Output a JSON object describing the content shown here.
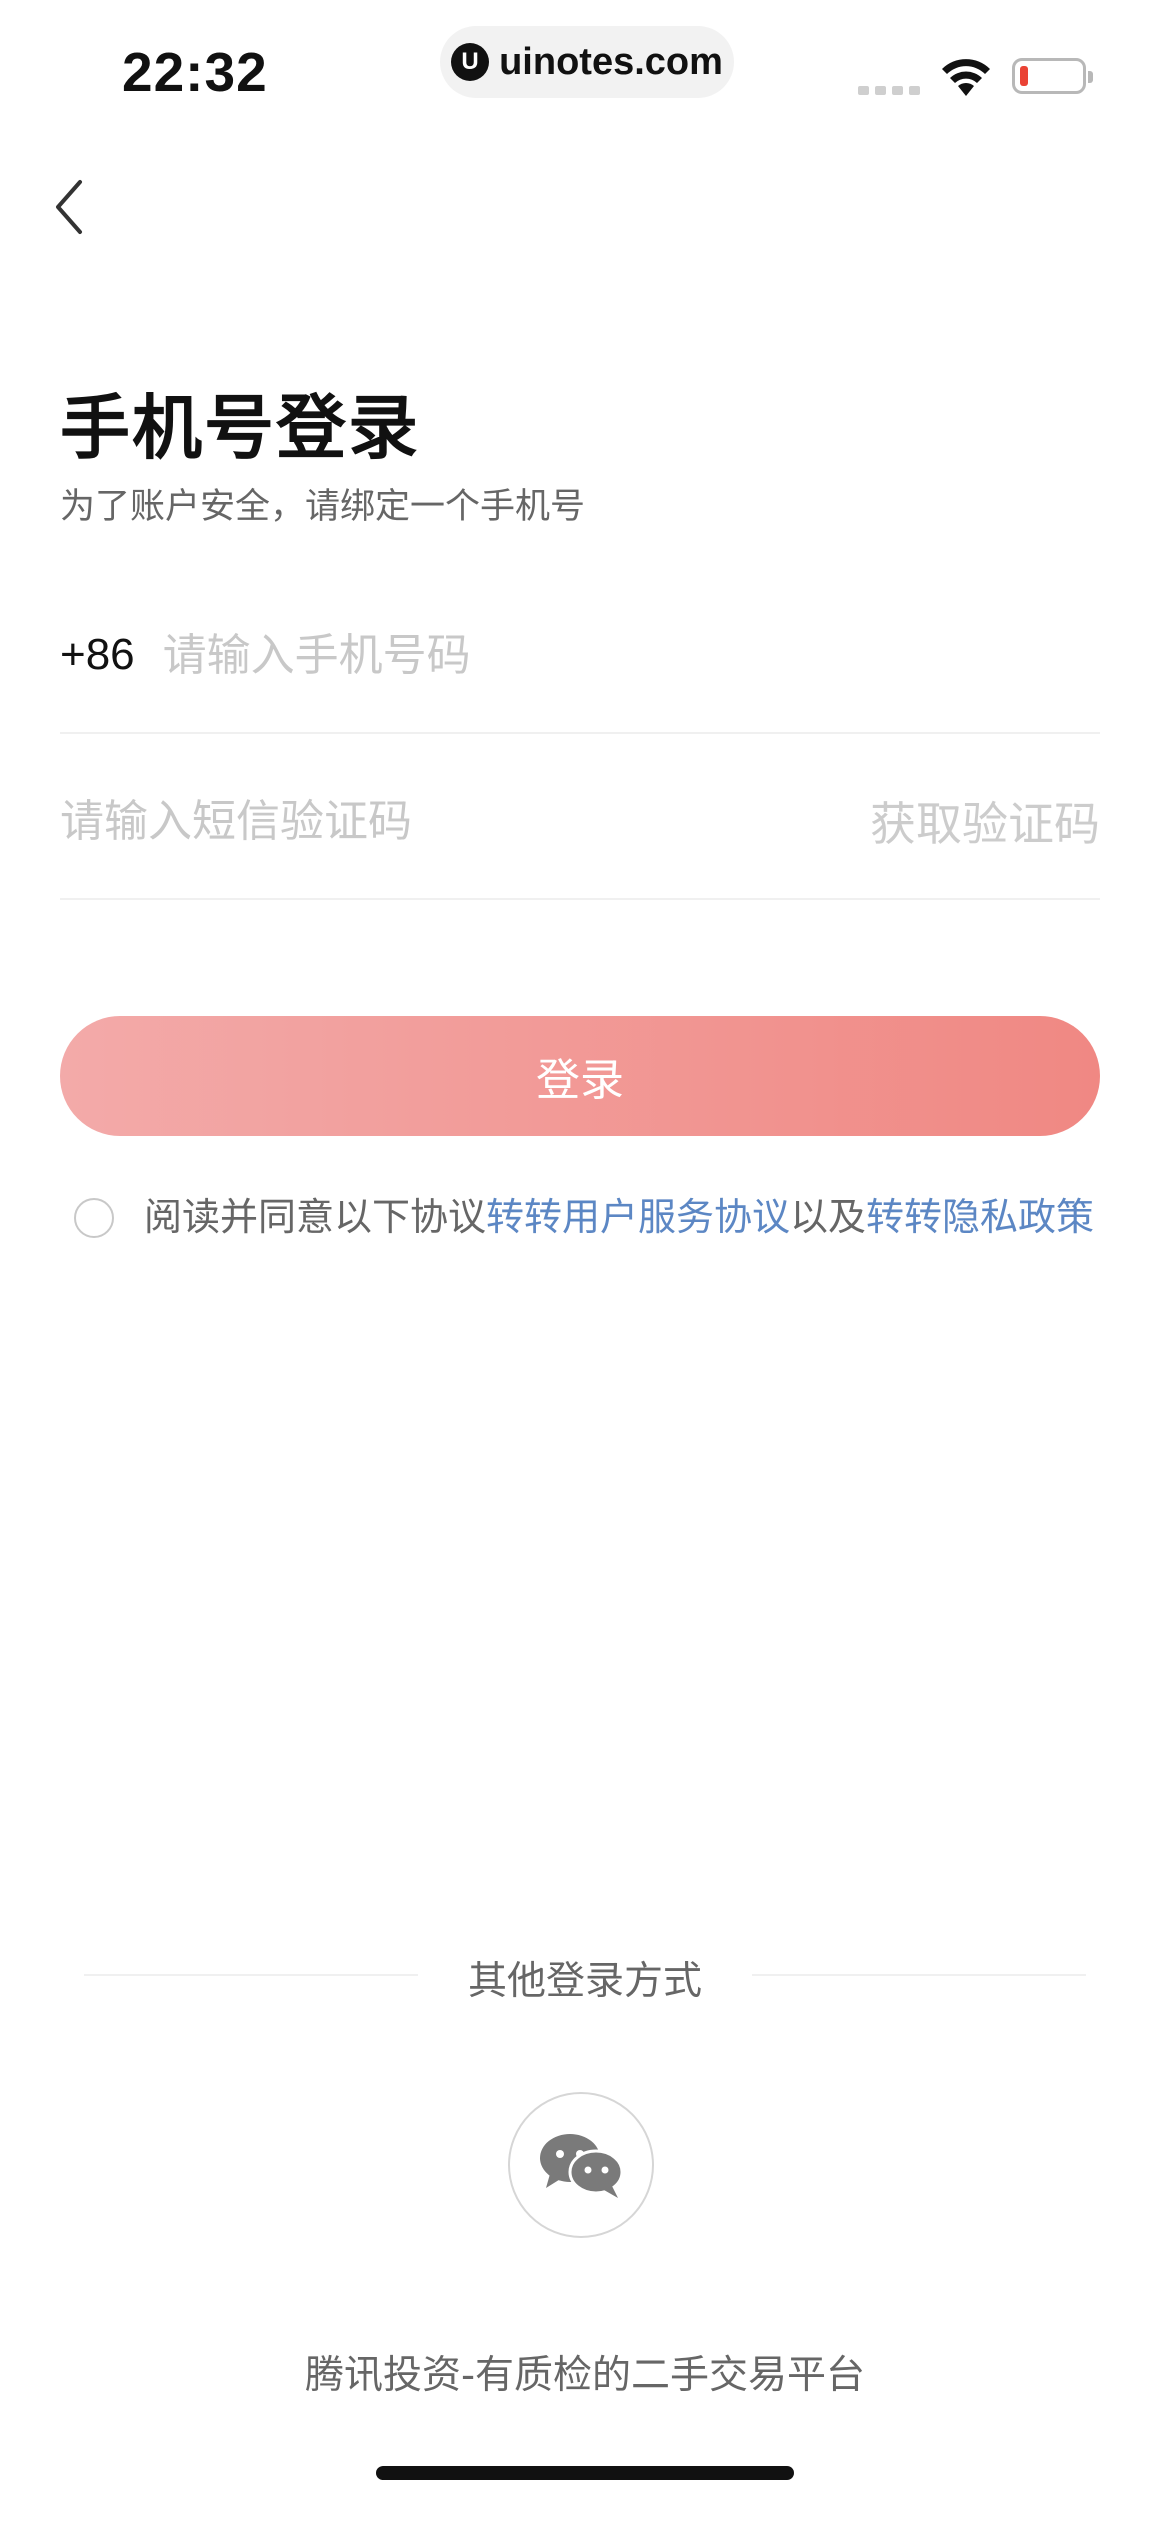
{
  "status_bar": {
    "time": "22:32",
    "url": "uinotes.com",
    "url_logo": "U",
    "icons": [
      "signal-dots-icon",
      "wifi-icon",
      "battery-low-icon"
    ],
    "battery_color": "#ea4335"
  },
  "nav": {
    "back_icon": "chevron-left-icon"
  },
  "header": {
    "title": "手机号登录",
    "subtitle": "为了账户安全，请绑定一个手机号"
  },
  "form": {
    "country_code": "+86",
    "phone_value": "",
    "phone_placeholder": "请输入手机号码",
    "code_value": "",
    "code_placeholder": "请输入短信验证码",
    "get_code_label": "获取验证码"
  },
  "login_button": {
    "label": "登录",
    "gradient_start": "#f3aaa9",
    "gradient_end": "#f08883"
  },
  "agreement": {
    "checked": false,
    "prefix": "阅读并同意以下协议",
    "link1": "转转用户服务协议",
    "middle": "以及",
    "link2": "转转隐私政策",
    "link_color": "#5c87c4"
  },
  "other_login": {
    "title": "其他登录方式",
    "methods": [
      {
        "icon": "wechat-icon"
      }
    ]
  },
  "footer": {
    "slogan": "腾讯投资-有质检的二手交易平台"
  }
}
